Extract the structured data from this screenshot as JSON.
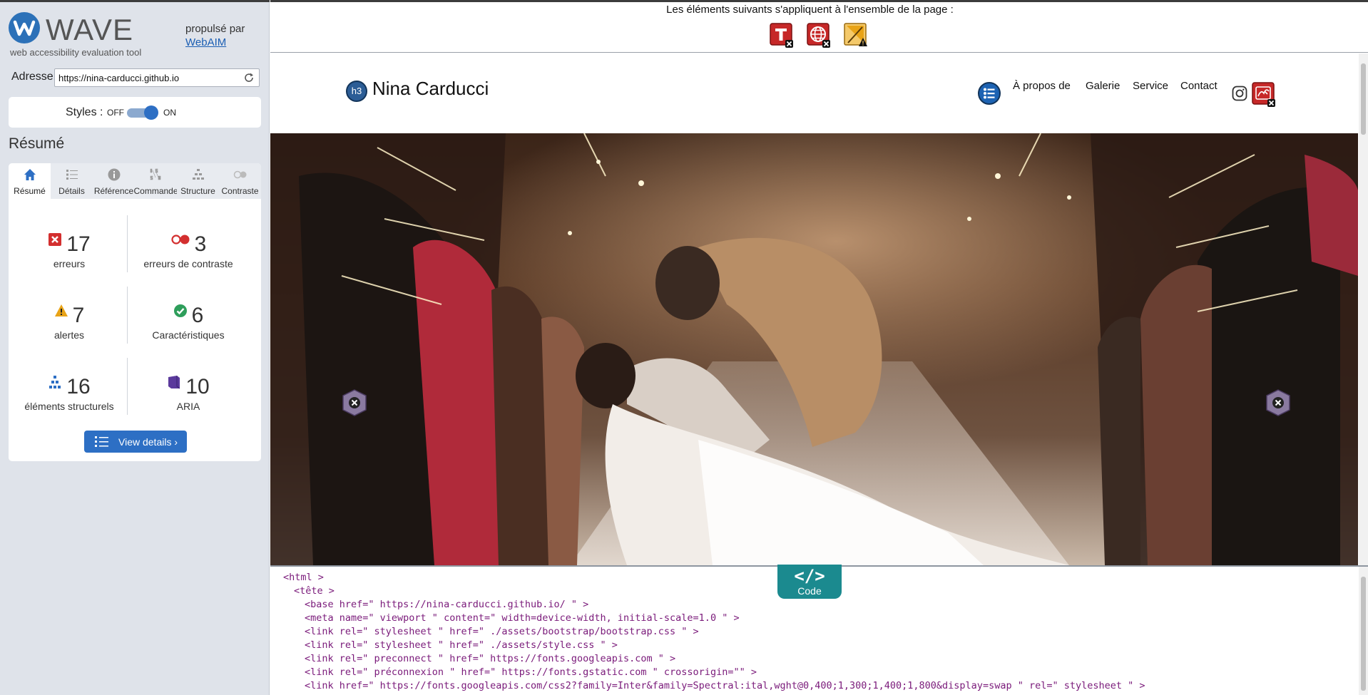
{
  "sidebar": {
    "brand_name": "WAVE",
    "brand_tagline": "web accessibility evaluation tool",
    "powered_by": "propulsé par",
    "powered_link": "WebAIM",
    "address_label": "Adresse:",
    "address_value": "https://nina-carducci.github.io",
    "styles_label": "Styles :",
    "styles_off": "OFF",
    "styles_on": "ON",
    "summary_title": "Résumé",
    "tabs": [
      {
        "label": "Résumé",
        "icon": "home-icon",
        "active": true
      },
      {
        "label": "Détails",
        "icon": "list-icon",
        "active": false
      },
      {
        "label": "Référence",
        "icon": "info-icon",
        "active": false
      },
      {
        "label": "Commande",
        "icon": "order-icon",
        "active": false
      },
      {
        "label": "Structure",
        "icon": "structure-icon",
        "active": false
      },
      {
        "label": "Contraste",
        "icon": "contrast-icon",
        "active": false
      }
    ],
    "stats": [
      {
        "count": "17",
        "caption": "erreurs",
        "icon": "error-icon",
        "color": "#d32f2f"
      },
      {
        "count": "3",
        "caption": "erreurs de contraste",
        "icon": "contrast-error-icon",
        "color": "#d32f2f"
      },
      {
        "count": "7",
        "caption": "alertes",
        "icon": "alert-icon",
        "color": "#e8a317"
      },
      {
        "count": "6",
        "caption": "Caractéristiques",
        "icon": "feature-icon",
        "color": "#2e9e5b"
      },
      {
        "count": "16",
        "caption": "éléments structurels",
        "icon": "structure-icon",
        "color": "#2d6fc4"
      },
      {
        "count": "10",
        "caption": "ARIA",
        "icon": "aria-icon",
        "color": "#5b3a9c"
      }
    ],
    "view_details": "View details ›"
  },
  "main": {
    "page_message": "Les éléments suivants s'appliquent à l'ensemble de la page :",
    "page_icons": [
      "missing-title-icon",
      "language-missing-icon",
      "alert-icon"
    ],
    "site": {
      "heading_badge": "h3",
      "title": "Nina Carducci",
      "nav": [
        "À propos de",
        "Galerie",
        "Service",
        "Contact"
      ]
    },
    "code_tab_symbol": "</>",
    "code_tab_label": "Code",
    "code": [
      "<html >",
      "<tête >",
      "<base href=\" https://nina-carducci.github.io/ \" >",
      "<meta name=\" viewport \" content=\" width=device-width, initial-scale=1.0 \" >",
      "<link rel=\" stylesheet \" href=\" ./assets/bootstrap/bootstrap.css \" >",
      "<link rel=\" stylesheet \" href=\" ./assets/style.css \" >",
      "<link rel=\" preconnect \" href=\" https://fonts.googleapis.com \" >",
      "<link rel=\" préconnexion \" href=\" https://fonts.gstatic.com \" crossorigin=\"\" >",
      "<link href=\" https://fonts.googleapis.com/css2?family=Inter&family=Spectral:ital,wght@0,400;1,300;1,400;1,800&display=swap \" rel=\" stylesheet \" >"
    ]
  },
  "colors": {
    "accent": "#2d6fc4",
    "sidebar_bg": "#dfe3ea",
    "code_tab": "#1b8a8f"
  }
}
